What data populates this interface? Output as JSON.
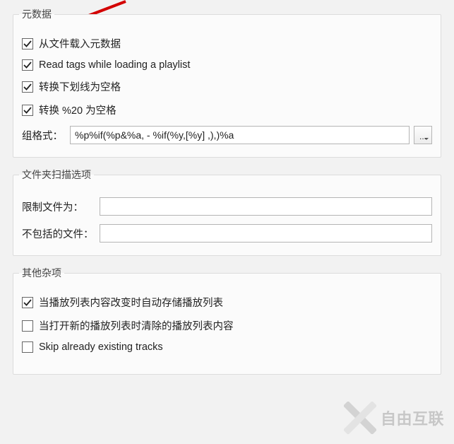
{
  "groups": {
    "metadata": {
      "legend": "元数据",
      "items": {
        "loadFromFile": {
          "label": "从文件载入元数据",
          "checked": true
        },
        "readTags": {
          "label": "Read tags while loading a playlist",
          "checked": true
        },
        "underscoreToSpace": {
          "label": "转换下划线为空格",
          "checked": true
        },
        "percent20ToSpace": {
          "label": "转换 %20 为空格",
          "checked": true
        }
      },
      "groupFormat": {
        "label": "组格式：",
        "value": "%p%if(%p&%a, - %if(%y,[%y] ,),)%a",
        "ellipsis": "..."
      }
    },
    "folderScan": {
      "legend": "文件夹扫描选项",
      "limitFiles": {
        "label": "限制文件为：",
        "value": ""
      },
      "excludeFiles": {
        "label": "不包括的文件：",
        "value": ""
      }
    },
    "misc": {
      "legend": "其他杂项",
      "items": {
        "autoSave": {
          "label": "当播放列表内容改变时自动存储播放列表",
          "checked": true
        },
        "clearOnNew": {
          "label": "当打开新的播放列表时清除的播放列表内容",
          "checked": false
        },
        "skipExisting": {
          "label": "Skip already existing tracks",
          "checked": false
        }
      }
    }
  },
  "watermark": {
    "text": "自由互联"
  }
}
